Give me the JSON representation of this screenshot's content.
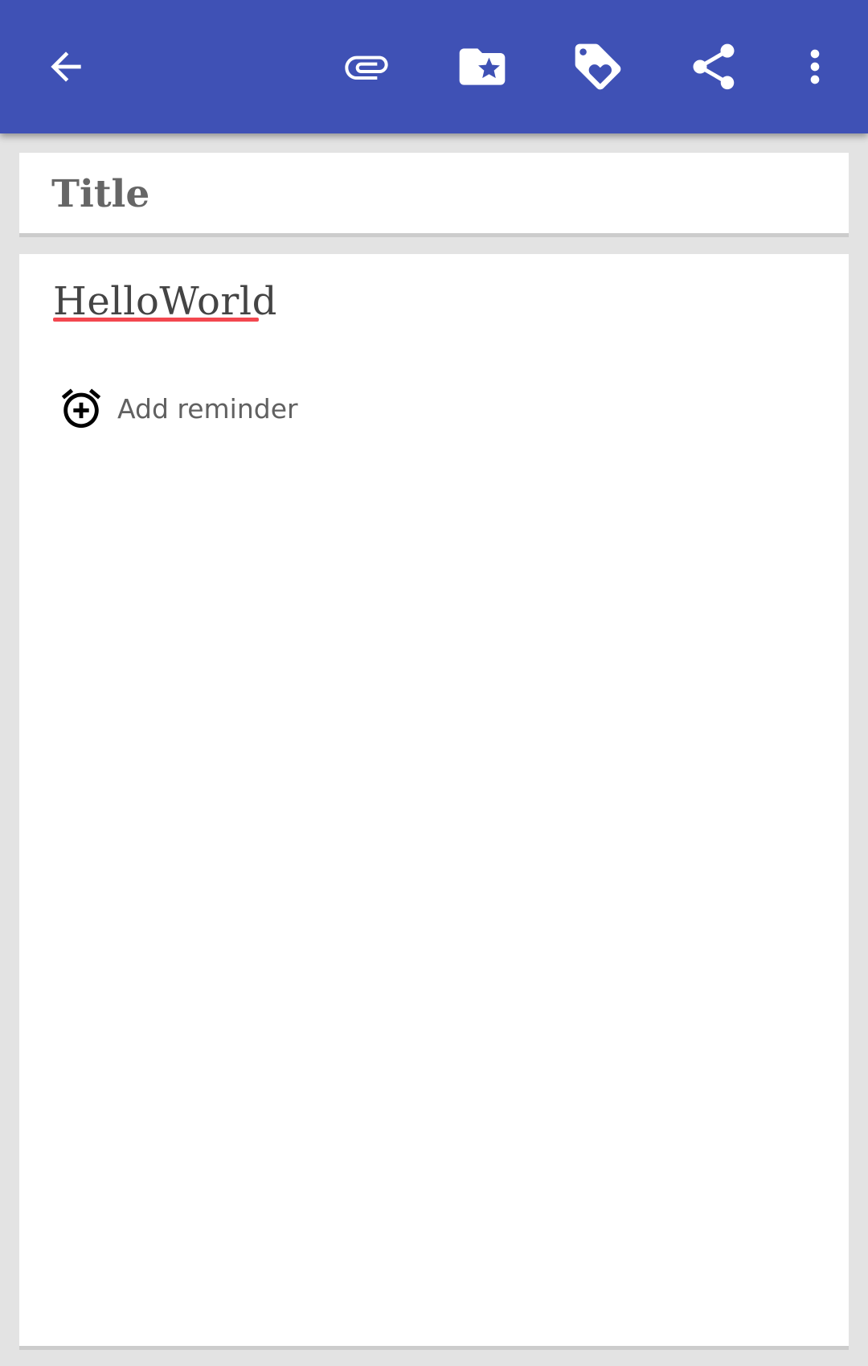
{
  "toolbar": {
    "background": "#3f51b5",
    "icons": [
      "arrow-left-icon",
      "paperclip-icon",
      "folder-star-icon",
      "tag-heart-icon",
      "share-icon",
      "more-vert-icon"
    ]
  },
  "note": {
    "title_placeholder": "Title",
    "content": "HelloWorld",
    "spellcheck_underline_color": "#f3474f"
  },
  "reminder": {
    "label": "Add reminder",
    "icon": "alarm-add-icon"
  }
}
